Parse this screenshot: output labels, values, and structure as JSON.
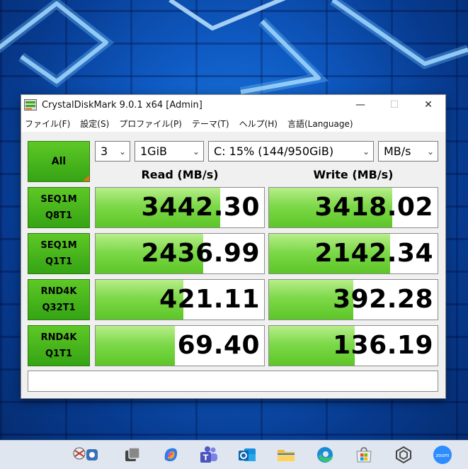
{
  "window": {
    "title": "CrystalDiskMark 9.0.1 x64 [Admin]",
    "controls": {
      "minimize": "—",
      "maximize": "☐",
      "close": "✕"
    }
  },
  "menu": [
    "ファイル(F)",
    "設定(S)",
    "プロファイル(P)",
    "テーマ(T)",
    "ヘルプ(H)",
    "言語(Language)"
  ],
  "controls": {
    "all_label": "All",
    "count": "3",
    "size": "1GiB",
    "drive": "C: 15% (144/950GiB)",
    "unit": "MB/s"
  },
  "headers": {
    "read": "Read (MB/s)",
    "write": "Write (MB/s)"
  },
  "tests": [
    {
      "line1": "SEQ1M",
      "line2": "Q8T1",
      "read": "3442.30",
      "write": "3418.02",
      "read_fill": 0.74,
      "write_fill": 0.73
    },
    {
      "line1": "SEQ1M",
      "line2": "Q1T1",
      "read": "2436.99",
      "write": "2142.34",
      "read_fill": 0.64,
      "write_fill": 0.72
    },
    {
      "line1": "RND4K",
      "line2": "Q32T1",
      "read": "421.11",
      "write": "392.28",
      "read_fill": 0.52,
      "write_fill": 0.5
    },
    {
      "line1": "RND4K",
      "line2": "Q1T1",
      "read": "69.40",
      "write": "136.19",
      "read_fill": 0.47,
      "write_fill": 0.51
    }
  ],
  "comment": "",
  "taskbar": [
    "weather-icon",
    "task-view-icon",
    "copilot-icon",
    "teams-icon",
    "outlook-icon",
    "file-explorer-icon",
    "edge-icon",
    "store-icon",
    "app-icon",
    "zoom-icon"
  ],
  "colors": {
    "accent_green": "#4cb91d",
    "bar_green": "#7ed94a",
    "corner_orange": "#e07018"
  }
}
